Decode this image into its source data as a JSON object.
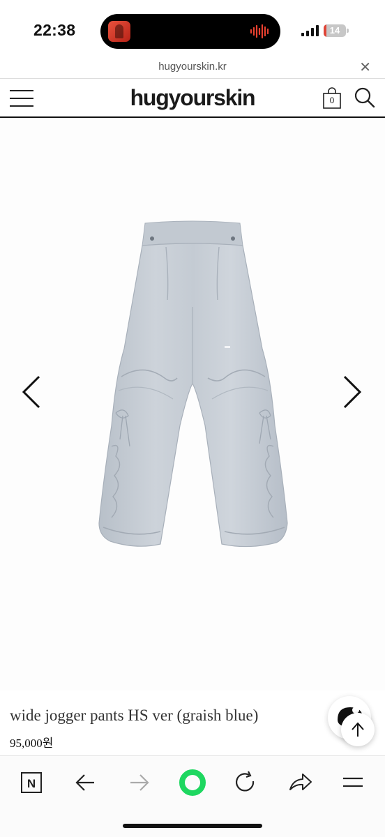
{
  "status_bar": {
    "time": "22:38",
    "battery": "14",
    "battery_level": 0.14
  },
  "browser": {
    "url": "hugyourskin.kr",
    "close_icon": "close-icon",
    "accent_color": "#1ed760"
  },
  "header": {
    "logo": "hugyourskin",
    "cart_count": "0"
  },
  "product": {
    "title": "wide jogger pants HS ver (graish blue)",
    "price": "95,000원",
    "image_color": "#c7ced6"
  }
}
